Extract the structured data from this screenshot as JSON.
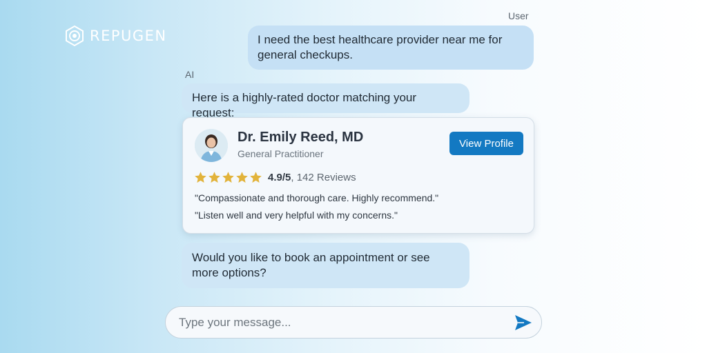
{
  "brand": {
    "name": "REPUGEN",
    "icon": "repugen-logo-icon"
  },
  "colors": {
    "accent": "#1379c2",
    "user_bubble": "#c5e0f5",
    "ai_bubble": "#cfe6f6",
    "star": "#e2b33b"
  },
  "chat": {
    "user_label": "User",
    "user_message": "I need the best healthcare provider near me for general checkups.",
    "ai_label": "AI",
    "ai_message_1": "Here is a highly-rated doctor matching your request:",
    "ai_message_2": "Would you like to book an appointment or see more options?"
  },
  "doctor_card": {
    "name": "Dr. Emily Reed, MD",
    "specialty": "General Practitioner",
    "view_profile_label": "View Profile",
    "stars": 5,
    "rating_score": "4.9/5",
    "rating_count": ", 142 Reviews",
    "reviews": [
      "\"Compassionate and thorough care. Highly recommend.\"",
      "\"Listen well and very helpful with my concerns.\""
    ]
  },
  "composer": {
    "placeholder": "Type your message...",
    "send_icon": "send-icon"
  }
}
